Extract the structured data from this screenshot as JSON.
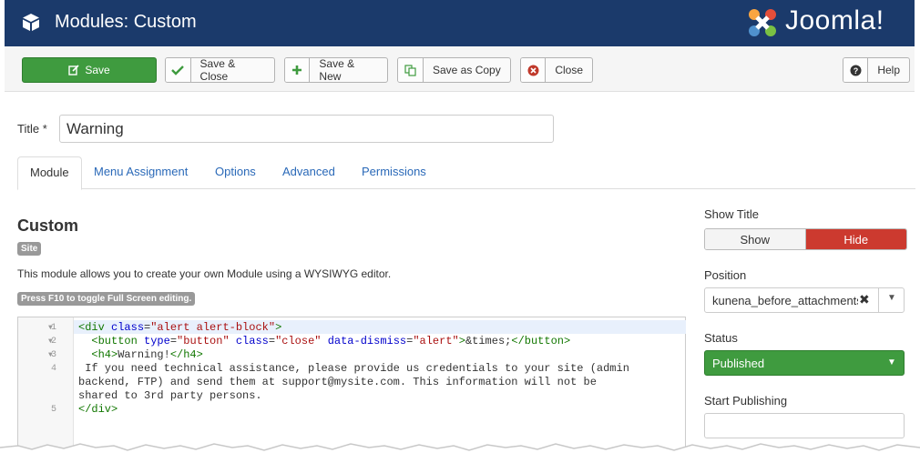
{
  "header": {
    "title": "Modules: Custom",
    "logo_text": "Joomla!"
  },
  "toolbar": {
    "save": "Save",
    "save_close": "Save & Close",
    "save_new": "Save & New",
    "save_copy": "Save as Copy",
    "close": "Close",
    "help": "Help"
  },
  "form": {
    "title_label": "Title *",
    "title_value": "Warning"
  },
  "tabs": [
    "Module",
    "Menu Assignment",
    "Options",
    "Advanced",
    "Permissions"
  ],
  "module": {
    "name": "Custom",
    "badge": "Site",
    "description": "This module allows you to create your own Module using a WYSIWYG editor.",
    "editor_hint": "Press F10 to toggle Full Screen editing."
  },
  "editor": {
    "line_numbers": [
      "1",
      "2",
      "3",
      "4",
      "5"
    ]
  },
  "sidebar": {
    "show_title_label": "Show Title",
    "show_label": "Show",
    "hide_label": "Hide",
    "position_label": "Position",
    "position_value": "kunena_before_attachments",
    "status_label": "Status",
    "status_value": "Published",
    "start_publishing_label": "Start Publishing",
    "start_publishing_value": ""
  },
  "colors": {
    "header_bg": "#1b3a6b",
    "save_green": "#3f9b3f",
    "hide_red": "#cc3a2f",
    "link_blue": "#2a69b8"
  }
}
